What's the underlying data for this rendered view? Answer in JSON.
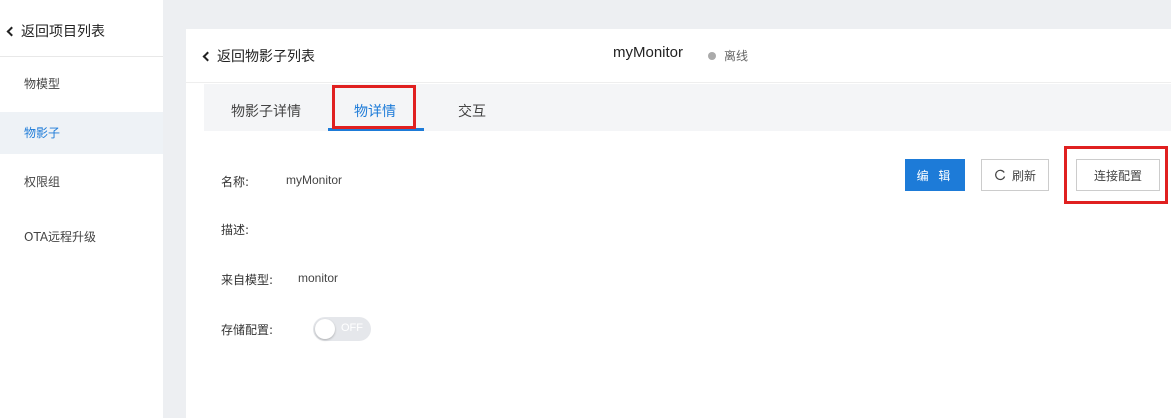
{
  "sidebar": {
    "back_label": "返回项目列表",
    "items": [
      {
        "label": "物模型",
        "active": false
      },
      {
        "label": "物影子",
        "active": true
      },
      {
        "label": "权限组",
        "active": false
      },
      {
        "label": "OTA远程升级",
        "active": false
      }
    ]
  },
  "header": {
    "back_label": "返回物影子列表",
    "title": "myMonitor",
    "status": "离线"
  },
  "tabs": [
    {
      "label": "物影子详情",
      "active": false
    },
    {
      "label": "物详情",
      "active": true
    },
    {
      "label": "交互",
      "active": false
    }
  ],
  "details": {
    "name_label": "名称:",
    "name_value": "myMonitor",
    "desc_label": "描述:",
    "model_label": "来自模型:",
    "model_value": "monitor",
    "storage_label": "存储配置:",
    "storage_toggle": "OFF"
  },
  "actions": {
    "edit_label": "编 辑",
    "refresh_label": "刷新",
    "connect_label": "连接配置"
  },
  "colors": {
    "accent": "#1d7bd8",
    "annotation": "#e02020",
    "status_dot": "#aaaaaa"
  }
}
